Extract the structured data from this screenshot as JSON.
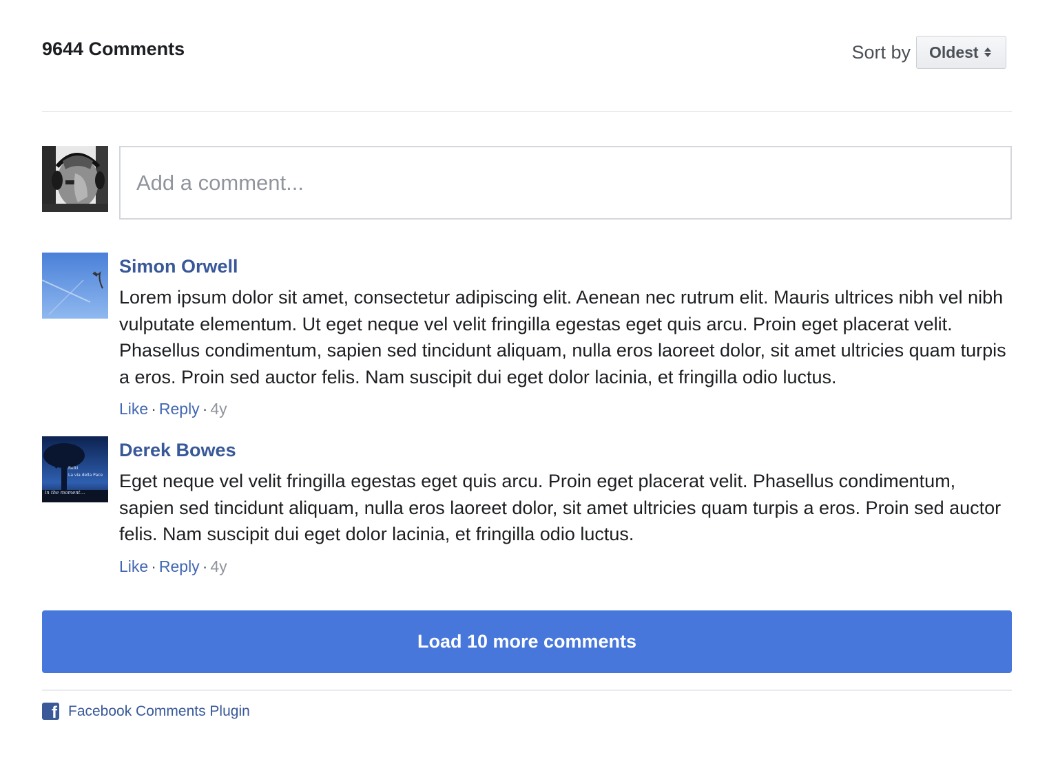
{
  "header": {
    "comment_count": "9644 Comments",
    "sort_label": "Sort by",
    "sort_value": "Oldest"
  },
  "composer": {
    "placeholder": "Add a comment..."
  },
  "comments": [
    {
      "author": "Simon Orwell",
      "text": "Lorem ipsum dolor sit amet, consectetur adipiscing elit. Aenean nec rutrum elit. Mauris ultrices nibh vel nibh vulputate elementum. Ut eget neque vel velit fringilla egestas eget quis arcu. Proin eget placerat velit. Phasellus condimentum, sapien sed tincidunt aliquam, nulla eros laoreet dolor, sit amet ultricies quam turpis a eros. Proin sed auctor felis. Nam suscipit dui eget dolor lacinia, et fringilla odio luctus.",
      "like": "Like",
      "reply": "Reply",
      "time": "4y"
    },
    {
      "author": "Derek Bowes",
      "text": "Eget neque vel velit fringilla egestas eget quis arcu. Proin eget placerat velit. Phasellus condimentum, sapien sed tincidunt aliquam, nulla eros laoreet dolor, sit amet ultricies quam turpis a eros. Proin sed auctor felis. Nam suscipit dui eget dolor lacinia, et fringilla odio luctus.",
      "like": "Like",
      "reply": "Reply",
      "time": "4y",
      "avatar_text": [
        "Reiki",
        "La via della Pace",
        "in the moment..."
      ]
    }
  ],
  "load_more": "Load 10 more comments",
  "footer": {
    "icon": "facebook-icon",
    "link": "Facebook Comments Plugin"
  },
  "colors": {
    "link": "#4267b2",
    "author": "#385898",
    "button": "#4777db",
    "divider": "#e9ebee"
  }
}
